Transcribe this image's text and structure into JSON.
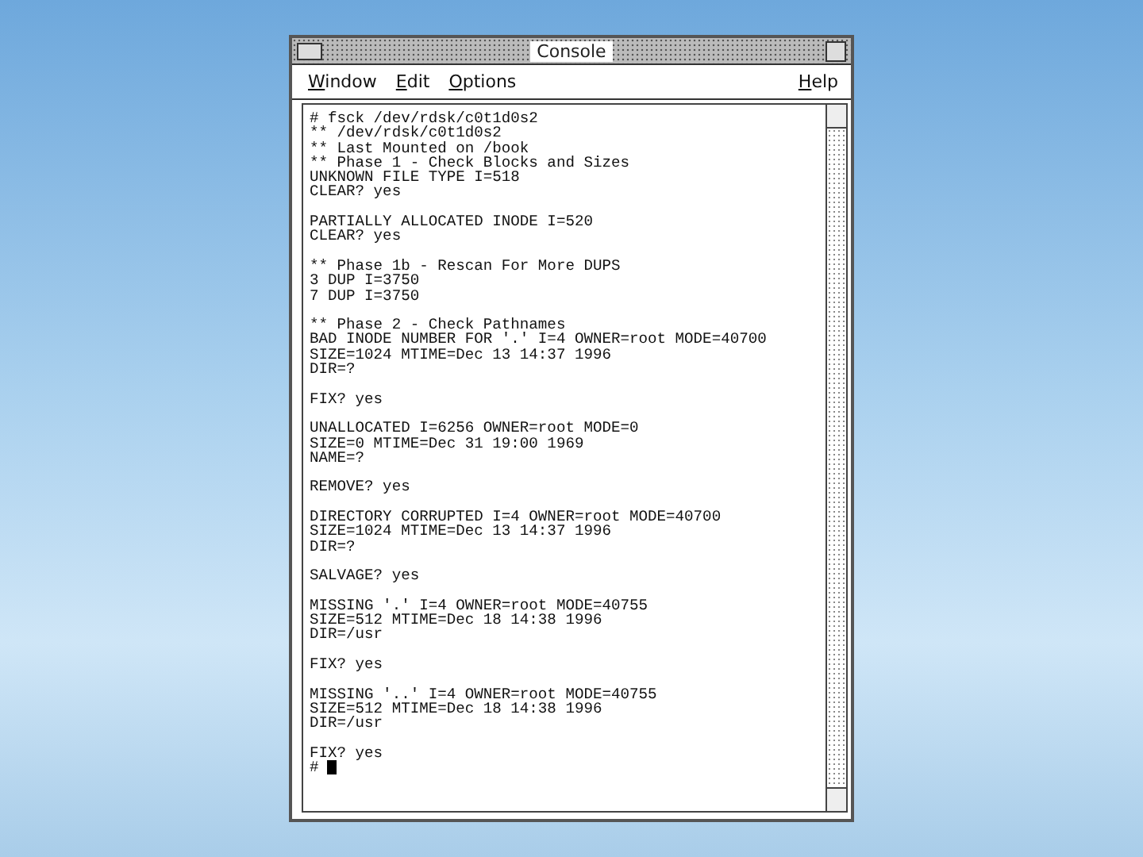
{
  "window": {
    "title": "Console"
  },
  "menu": [
    {
      "label": "Window"
    },
    {
      "label": "Edit"
    },
    {
      "label": "Options"
    },
    {
      "label": "Help"
    }
  ],
  "console": {
    "blocks": [
      [
        "# fsck /dev/rdsk/c0t1d0s2",
        "** /dev/rdsk/c0t1d0s2",
        "** Last Mounted on /book",
        "** Phase 1 - Check Blocks and Sizes",
        "UNKNOWN FILE TYPE I=518",
        "CLEAR? yes"
      ],
      [
        "PARTIALLY ALLOCATED INODE I=520",
        "CLEAR? yes"
      ],
      [
        "** Phase 1b - Rescan For More DUPS",
        "3 DUP I=3750",
        "7 DUP I=3750"
      ],
      [
        "** Phase 2 - Check Pathnames",
        "BAD INODE NUMBER FOR '.' I=4 OWNER=root MODE=40700",
        "SIZE=1024 MTIME=Dec 13 14:37 1996",
        "DIR=?"
      ],
      [
        "FIX? yes"
      ],
      [
        "UNALLOCATED I=6256 OWNER=root MODE=0",
        "SIZE=0 MTIME=Dec 31 19:00 1969",
        "NAME=?"
      ],
      [
        "REMOVE? yes"
      ],
      [
        "DIRECTORY CORRUPTED I=4 OWNER=root MODE=40700",
        "SIZE=1024 MTIME=Dec 13 14:37 1996",
        "DIR=?"
      ],
      [
        "SALVAGE? yes"
      ],
      [
        "MISSING '.' I=4 OWNER=root MODE=40755",
        "SIZE=512 MTIME=Dec 18 14:38 1996",
        "DIR=/usr"
      ],
      [
        "FIX? yes"
      ],
      [
        "MISSING '..' I=4 OWNER=root MODE=40755",
        "SIZE=512 MTIME=Dec 18 14:38 1996",
        "DIR=/usr"
      ],
      [
        "FIX? yes"
      ]
    ],
    "prompt": "#"
  }
}
